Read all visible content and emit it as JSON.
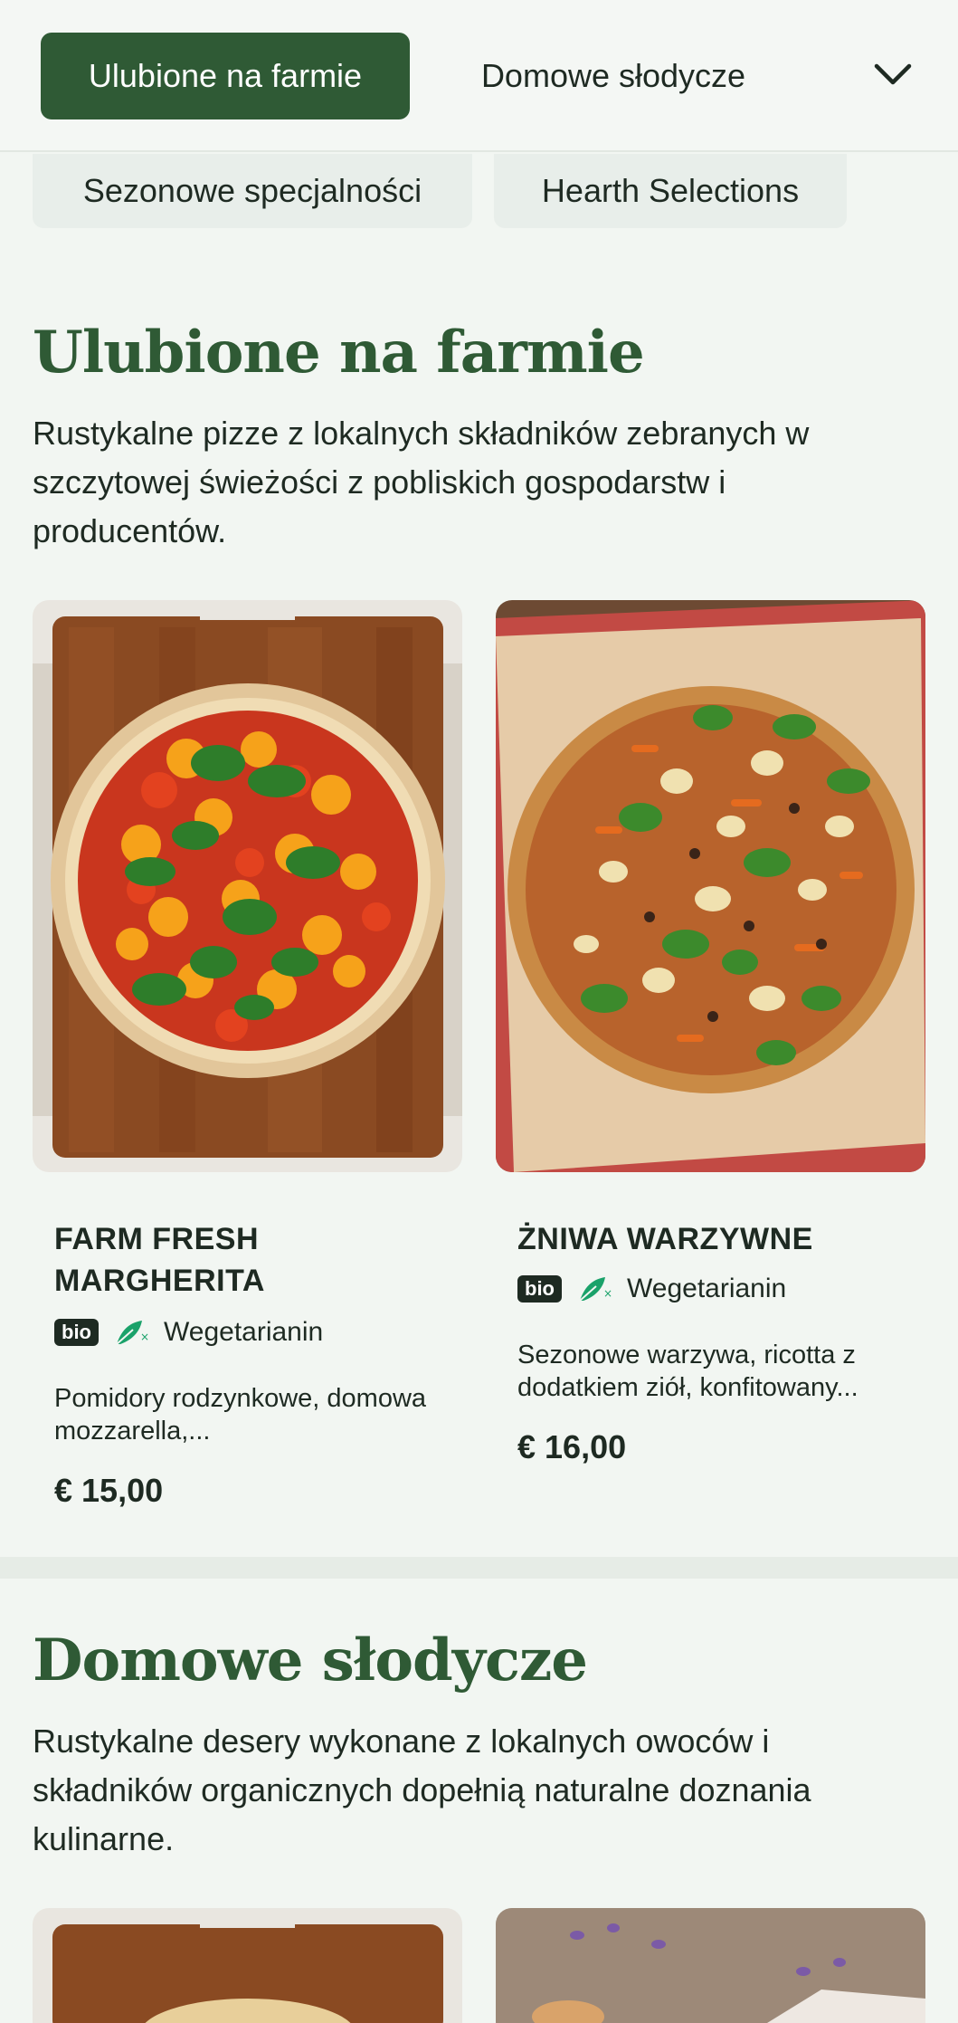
{
  "tabs": {
    "active": "Ulubione na farmie",
    "second": "Domowe słodycze",
    "pills": [
      "Sezonowe specjalności",
      "Hearth Selections"
    ]
  },
  "sections": [
    {
      "title": "Ulubione na farmie",
      "description": "Rustykalne pizze z lokalnych składników zebranych w szczytowej świeżości z pobliskich gospodarstw i producentów.",
      "items": [
        {
          "title": "FARM FRESH MARGHERITA",
          "badge": "bio",
          "diet_label": "Wegetarianin",
          "description": "Pomidory rodzynkowe, domowa mozzarella,...",
          "price": "€ 15,00"
        },
        {
          "title": "ŻNIWA WARZYWNE",
          "badge": "bio",
          "diet_label": "Wegetarianin",
          "description": "Sezonowe warzywa, ricotta z dodatkiem ziół, konfitowany...",
          "price": "€ 16,00"
        }
      ]
    },
    {
      "title": "Domowe słodycze",
      "description": "Rustykalne desery wykonane z lokalnych owoców i składników organicznych dopełnią naturalne doznania kulinarne."
    }
  ],
  "colors": {
    "accent": "#2f5a35",
    "background": "#f2f6f2",
    "vegetarian_icon": "#1aa26a"
  },
  "icons": [
    "chevron-down-icon",
    "vegetarian-leaf-icon"
  ]
}
